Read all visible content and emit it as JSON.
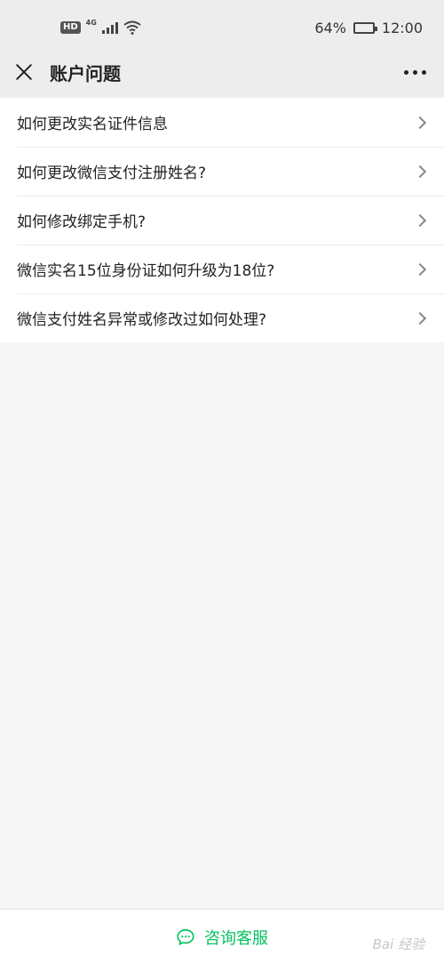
{
  "status_bar": {
    "hd": "HD",
    "network": "4G",
    "battery_percent": "64%",
    "battery_level": 0.64,
    "time": "12:00"
  },
  "nav": {
    "title": "账户问题",
    "close_icon": "close-icon",
    "more_icon": "more-dots-icon"
  },
  "list": {
    "items": [
      {
        "label": "如何更改实名证件信息"
      },
      {
        "label": "如何更改微信支付注册姓名?"
      },
      {
        "label": "如何修改绑定手机?"
      },
      {
        "label": "微信实名15位身份证如何升级为18位?"
      },
      {
        "label": "微信支付姓名异常或修改过如何处理?"
      }
    ]
  },
  "bottom": {
    "label": "咨询客服",
    "icon": "chat-bubble-icon",
    "accent": "#07c160"
  },
  "watermark": "Bai 经验"
}
